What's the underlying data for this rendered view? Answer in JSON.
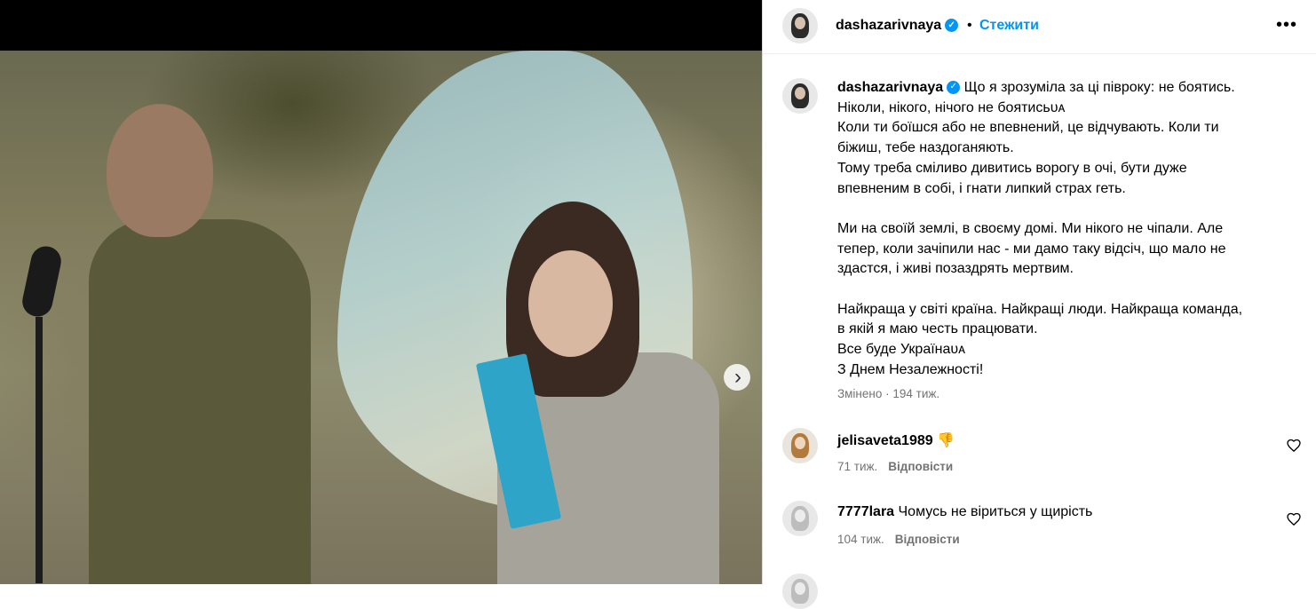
{
  "post": {
    "author": "dashazarivnaya",
    "follow_label": "Стежити",
    "separator": "•",
    "more_label": "•••",
    "verified_glyph": "✓",
    "next_glyph": "›",
    "caption_first": "Що я зрозуміла за ці півроку: не боятись.",
    "caption_lines": [
      "Ніколи, нікого, нічого не боятисьᴜᴀ",
      "Коли ти боїшся або не впевнений, це відчувають. Коли ти",
      "біжиш, тебе наздоганяють.",
      "Тому треба сміливо дивитись ворогу в очі, бути дуже",
      "впевненим в собі, і гнати липкий страх геть.",
      "",
      "Ми на своїй землі, в своєму домі. Ми нікого не чіпали. Але",
      "тепер, коли зачіпили нас - ми дамо таку відсіч, що мало не",
      "здастся, і живі позаздрять мертвим.",
      "",
      "Найкраща у світі країна. Найкращі люди. Найкраща команда,",
      "в якій я маю честь працювати.",
      "Все буде Українаᴜᴀ",
      "З Днем Незалежності!"
    ],
    "edited_label": "Змінено",
    "edited_time": "194 тиж."
  },
  "comments": [
    {
      "user": "jelisaveta1989",
      "text": "👎",
      "time": "71 тиж.",
      "reply": "Відповісти"
    },
    {
      "user": "7777lara",
      "text": "Чомусь не віриться у щирість",
      "time": "104 тиж.",
      "reply": "Відповісти"
    }
  ],
  "colors": {
    "accent": "#0095f6",
    "muted": "#737373"
  },
  "icons": {
    "heart": "heart-icon",
    "more": "more-options-icon",
    "verified": "verified-badge-icon",
    "next": "chevron-right-icon"
  }
}
